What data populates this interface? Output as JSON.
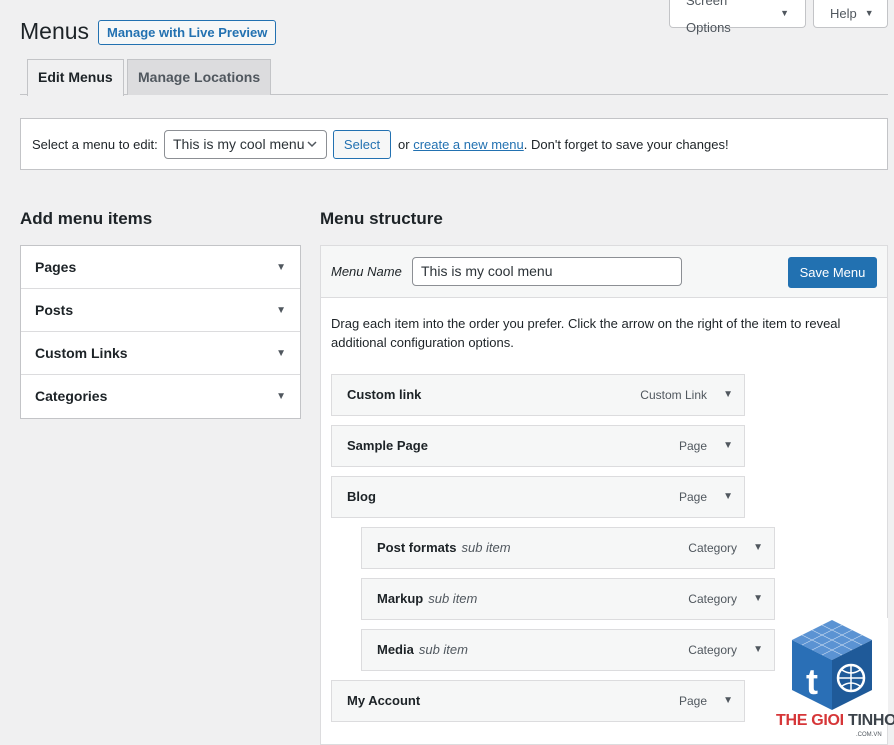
{
  "header": {
    "title": "Menus",
    "live_preview_label": "Manage with Live Preview",
    "screen_options_label": "Screen Options",
    "help_label": "Help"
  },
  "tabs": [
    {
      "label": "Edit Menus",
      "active": true
    },
    {
      "label": "Manage Locations",
      "active": false
    }
  ],
  "select_bar": {
    "label": "Select a menu to edit:",
    "selected_menu": "This is my cool menu",
    "select_button": "Select",
    "or_text": "or",
    "create_link": "create a new menu",
    "tail_text": ". Don't forget to save your changes!"
  },
  "add_items": {
    "heading": "Add menu items",
    "sections": [
      "Pages",
      "Posts",
      "Custom Links",
      "Categories"
    ]
  },
  "structure": {
    "heading": "Menu structure",
    "menu_name_label": "Menu Name",
    "menu_name_value": "This is my cool menu",
    "save_label": "Save Menu",
    "instructions": "Drag each item into the order you prefer. Click the arrow on the right of the item to reveal additional configuration options.",
    "items": [
      {
        "title": "Custom link",
        "sub": "",
        "type": "Custom Link",
        "depth": 0
      },
      {
        "title": "Sample Page",
        "sub": "",
        "type": "Page",
        "depth": 0
      },
      {
        "title": "Blog",
        "sub": "",
        "type": "Page",
        "depth": 0
      },
      {
        "title": "Post formats",
        "sub": "sub item",
        "type": "Category",
        "depth": 1
      },
      {
        "title": "Markup",
        "sub": "sub item",
        "type": "Category",
        "depth": 1
      },
      {
        "title": "Media",
        "sub": "sub item",
        "type": "Category",
        "depth": 1
      },
      {
        "title": "My Account",
        "sub": "",
        "type": "Page",
        "depth": 0
      }
    ]
  },
  "watermark": {
    "brand_part1": "THE GIOI ",
    "brand_part2": "TINHOC",
    "domain": ".COM.VN"
  },
  "colors": {
    "accent": "#2271b1",
    "background": "#f0f0f1",
    "watermark_red": "#d63638",
    "watermark_blue": "#2a6fb6"
  }
}
